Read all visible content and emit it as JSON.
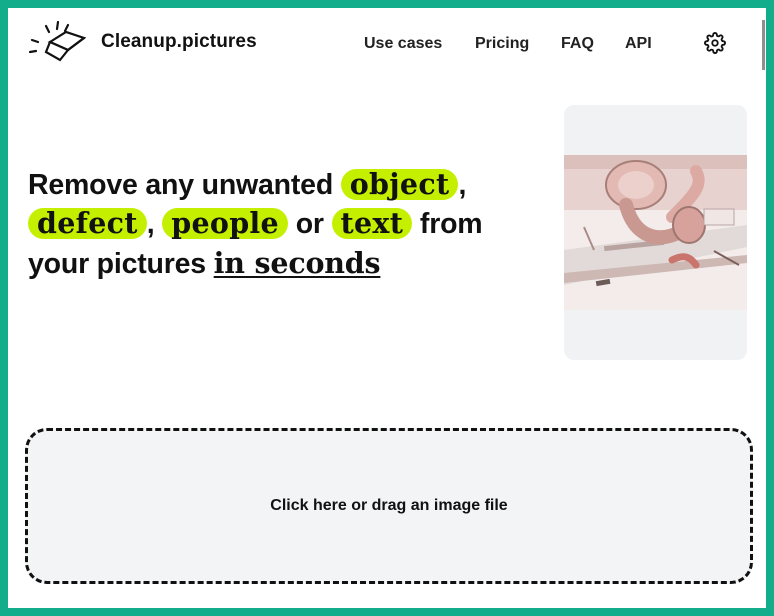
{
  "brand": {
    "name": "Cleanup.pictures",
    "logo_icon": "eraser-icon"
  },
  "nav": {
    "items": [
      {
        "label": "Use cases"
      },
      {
        "label": "Pricing"
      },
      {
        "label": "FAQ"
      },
      {
        "label": "API"
      }
    ],
    "settings_icon": "gear-icon"
  },
  "hero": {
    "line1_text": "Remove any unwanted ",
    "word_object": "object",
    "comma1": ",",
    "word_defect": "defect",
    "comma2": ", ",
    "word_people": "people",
    "or_text": " or ",
    "word_text": "text",
    "from_text": " from",
    "line3_text": "your pictures ",
    "underline_text": "in seconds",
    "highlight_color": "#c4f000"
  },
  "preview": {
    "image_alt": "pink headphones on a desk with a retouching stroke"
  },
  "upload": {
    "label": "Click here or drag an image file"
  },
  "colors": {
    "frame": "#14ad8c",
    "text": "#111111"
  }
}
